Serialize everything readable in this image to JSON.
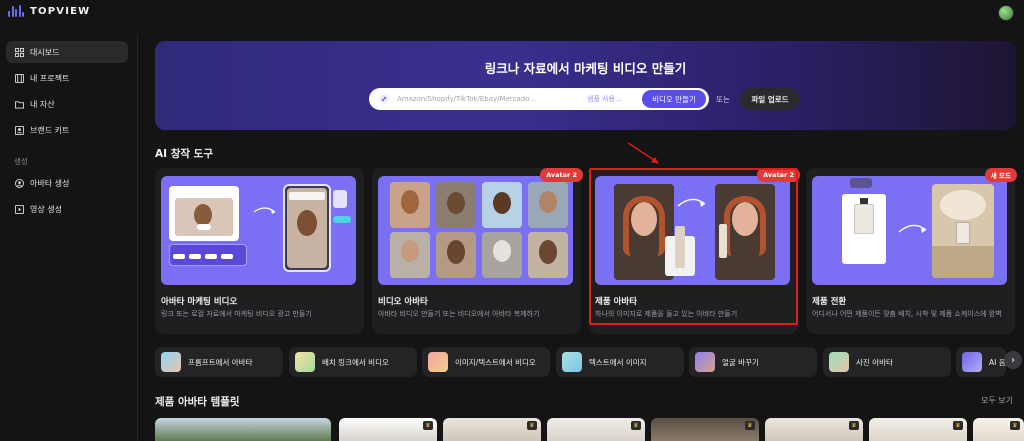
{
  "header": {
    "brand": "TOPVIEW",
    "logo_icon": "topview-waveform-logo",
    "avatar_icon": "user-avatar"
  },
  "sidebar": {
    "items": [
      {
        "label": "대시보드",
        "icon": "dashboard-grid-icon",
        "active": true
      },
      {
        "label": "내 프로젝트",
        "icon": "film-icon"
      },
      {
        "label": "내 자산",
        "icon": "folder-icon"
      },
      {
        "label": "브랜드 키트",
        "icon": "brand-kit-icon"
      }
    ],
    "section_label": "생성",
    "gen_items": [
      {
        "label": "아바타 생성",
        "icon": "avatar-circle-icon"
      },
      {
        "label": "영상 생성",
        "icon": "video-play-icon"
      }
    ]
  },
  "hero": {
    "title": "링크나 자료에서 마케팅 비디오 만들기",
    "search_placeholder": "Amazon/Shopify/TikTok/Ebay/Mercado...",
    "search_value": "",
    "sample_link": "샘플 사용...",
    "create_button": "비디오 만들기",
    "or_text": "또는",
    "upload_button": "파일 업로드"
  },
  "ai_tools": {
    "title": "AI 창작 도구",
    "cards": [
      {
        "title": "아바타 마케팅 비디오",
        "desc": "링크 또는 로컬 자료에서 마케팅 비디오 광고 만들기",
        "badge": ""
      },
      {
        "title": "비디오 아바타",
        "desc": "아바타 비디오 만들기 또는 비디오에서 아바타 복제하기",
        "badge": "Avatar 2"
      },
      {
        "title": "제품 아바타",
        "desc": "하나의 이미지로 제품을 들고 있는 아바타 만들기",
        "badge": "Avatar 2"
      },
      {
        "title": "제품 전환",
        "desc": "어디서나 어떤 제품이든 맞춤 배치, 시착 및 제품 쇼케이스에 완벽",
        "badge": "새 모드"
      }
    ],
    "chips": [
      {
        "label": "프롬프트에서 아바타"
      },
      {
        "label": "배치 링크에서 비디오"
      },
      {
        "label": "이미지/텍스트에서 비디오"
      },
      {
        "label": "텍스트에서 이미지"
      },
      {
        "label": "얼굴 바꾸기"
      },
      {
        "label": "사진 아바타"
      },
      {
        "label": "AI 음"
      }
    ],
    "scroll_icon": "chevron-right-icon"
  },
  "templates": {
    "title": "제품 아바타 템플릿",
    "see_all": "모두 보기",
    "crown_icon": "crown-icon"
  },
  "colors": {
    "accent": "#5b4ee8",
    "badge_red": "#e23a3a",
    "highlight_red": "#e01b1b",
    "card_purple": "#7a6df2",
    "background": "#141414"
  }
}
